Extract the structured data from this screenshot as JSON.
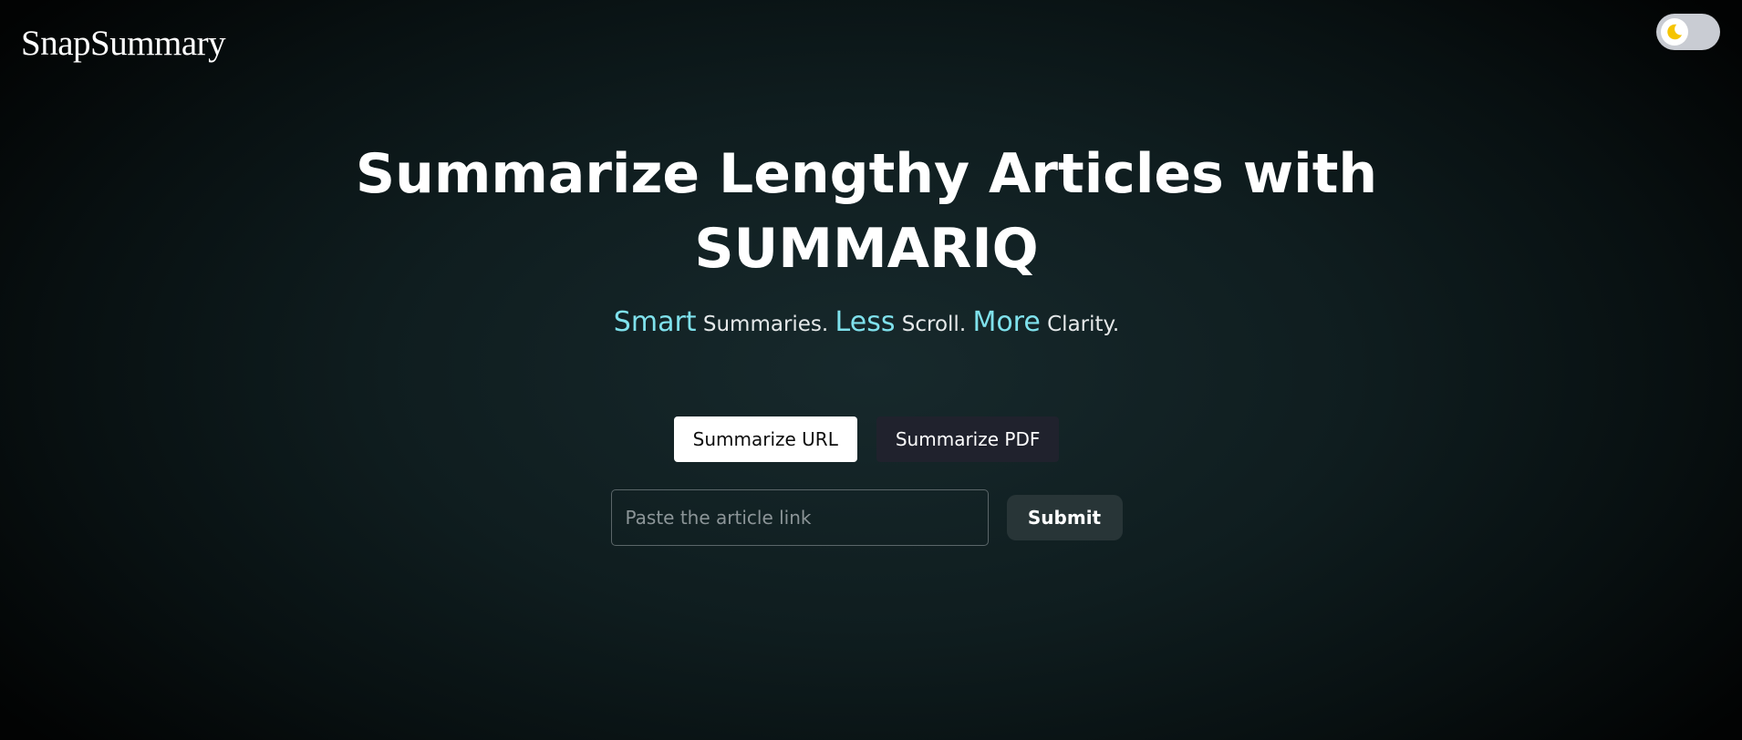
{
  "header": {
    "brand": "SnapSummary",
    "theme_toggle": {
      "icon": "moon-icon",
      "mode": "dark",
      "knob_color": "#ffffff",
      "track_color": "#c9ccd3",
      "moon_color": "#f5c400"
    }
  },
  "hero": {
    "title_line1": "Summarize Lengthy Articles with",
    "title_line2": "SUMMARIQ",
    "tagline": [
      {
        "highlight": "Smart",
        "text": "Summaries."
      },
      {
        "highlight": "Less",
        "text": "Scroll."
      },
      {
        "highlight": "More",
        "text": "Clarity."
      }
    ],
    "highlight_color": "#7fe1ec"
  },
  "tabs": {
    "items": [
      {
        "label": "Summarize URL",
        "active": true
      },
      {
        "label": "Summarize PDF",
        "active": false
      }
    ]
  },
  "url_form": {
    "input_value": "",
    "input_placeholder": "Paste the article link",
    "submit_label": "Submit"
  }
}
